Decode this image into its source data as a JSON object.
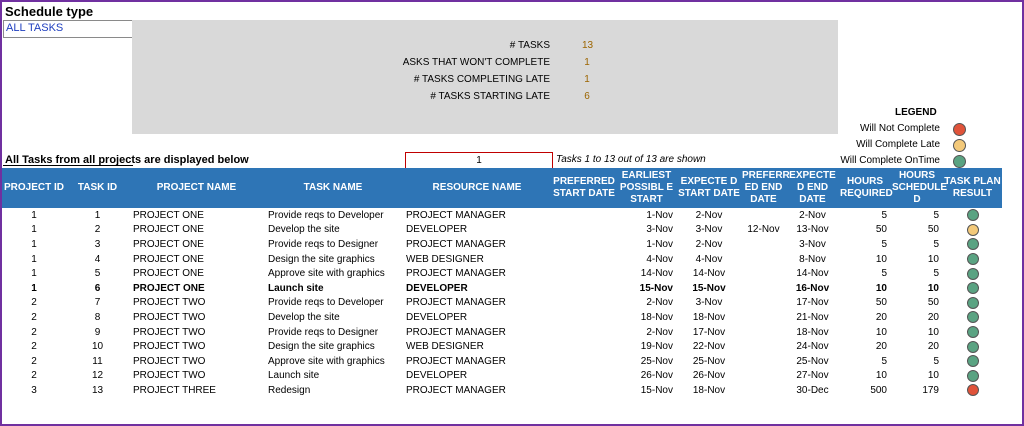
{
  "schedule": {
    "title": "Schedule type",
    "selected": "ALL TASKS"
  },
  "stats": [
    {
      "label": "# TASKS",
      "value": "13"
    },
    {
      "label": "ASKS THAT WON'T COMPLETE",
      "value": "1"
    },
    {
      "label": "# TASKS COMPLETING LATE",
      "value": "1"
    },
    {
      "label": "# TASKS STARTING LATE",
      "value": "6"
    }
  ],
  "legend": {
    "title": "LEGEND",
    "items": [
      {
        "label": "Will Not Complete",
        "color": "#e0533a"
      },
      {
        "label": "Will Complete Late",
        "color": "#f3c97a"
      },
      {
        "label": "Will Complete OnTime",
        "color": "#5aa382"
      }
    ]
  },
  "list_info": {
    "all_tasks_label": "All Tasks from all projects are displayed below",
    "page_value": "1",
    "shown_text": "Tasks 1 to 13 out of 13 are shown"
  },
  "columns": [
    "PROJECT ID",
    "TASK ID",
    "PROJECT NAME",
    "TASK NAME",
    "RESOURCE NAME",
    "PREFERRED START DATE",
    "EARLIEST POSSIBL E START",
    "EXPECTE D START DATE",
    "PREFERR ED END DATE",
    "EXPECTE D END DATE",
    "HOURS REQUIRED",
    "HOURS SCHEDULE D",
    "TASK PLAN RESULT"
  ],
  "rows": [
    {
      "project_id": "1",
      "task_id": "1",
      "project_name": "PROJECT ONE",
      "task_name": "Provide reqs to Developer",
      "resource": "PROJECT MANAGER",
      "pref_start": "",
      "earliest": "1-Nov",
      "exp_start": "2-Nov",
      "pref_end": "",
      "exp_end": "2-Nov",
      "hours_req": "5",
      "hours_sched": "5",
      "result": "green",
      "bold": false
    },
    {
      "project_id": "1",
      "task_id": "2",
      "project_name": "PROJECT ONE",
      "task_name": "Develop the site",
      "resource": "DEVELOPER",
      "pref_start": "",
      "earliest": "3-Nov",
      "exp_start": "3-Nov",
      "pref_end": "12-Nov",
      "exp_end": "13-Nov",
      "hours_req": "50",
      "hours_sched": "50",
      "result": "yellow",
      "bold": false
    },
    {
      "project_id": "1",
      "task_id": "3",
      "project_name": "PROJECT ONE",
      "task_name": "Provide reqs to Designer",
      "resource": "PROJECT MANAGER",
      "pref_start": "",
      "earliest": "1-Nov",
      "exp_start": "2-Nov",
      "pref_end": "",
      "exp_end": "3-Nov",
      "hours_req": "5",
      "hours_sched": "5",
      "result": "green",
      "bold": false
    },
    {
      "project_id": "1",
      "task_id": "4",
      "project_name": "PROJECT ONE",
      "task_name": "Design the site graphics",
      "resource": "WEB DESIGNER",
      "pref_start": "",
      "earliest": "4-Nov",
      "exp_start": "4-Nov",
      "pref_end": "",
      "exp_end": "8-Nov",
      "hours_req": "10",
      "hours_sched": "10",
      "result": "green",
      "bold": false
    },
    {
      "project_id": "1",
      "task_id": "5",
      "project_name": "PROJECT ONE",
      "task_name": "Approve site with graphics",
      "resource": "PROJECT MANAGER",
      "pref_start": "",
      "earliest": "14-Nov",
      "exp_start": "14-Nov",
      "pref_end": "",
      "exp_end": "14-Nov",
      "hours_req": "5",
      "hours_sched": "5",
      "result": "green",
      "bold": false
    },
    {
      "project_id": "1",
      "task_id": "6",
      "project_name": "PROJECT ONE",
      "task_name": "Launch site",
      "resource": "DEVELOPER",
      "pref_start": "",
      "earliest": "15-Nov",
      "exp_start": "15-Nov",
      "pref_end": "",
      "exp_end": "16-Nov",
      "hours_req": "10",
      "hours_sched": "10",
      "result": "green",
      "bold": true
    },
    {
      "project_id": "2",
      "task_id": "7",
      "project_name": "PROJECT TWO",
      "task_name": "Provide reqs to Developer",
      "resource": "PROJECT MANAGER",
      "pref_start": "",
      "earliest": "2-Nov",
      "exp_start": "3-Nov",
      "pref_end": "",
      "exp_end": "17-Nov",
      "hours_req": "50",
      "hours_sched": "50",
      "result": "green",
      "bold": false
    },
    {
      "project_id": "2",
      "task_id": "8",
      "project_name": "PROJECT TWO",
      "task_name": "Develop the site",
      "resource": "DEVELOPER",
      "pref_start": "",
      "earliest": "18-Nov",
      "exp_start": "18-Nov",
      "pref_end": "",
      "exp_end": "21-Nov",
      "hours_req": "20",
      "hours_sched": "20",
      "result": "green",
      "bold": false
    },
    {
      "project_id": "2",
      "task_id": "9",
      "project_name": "PROJECT TWO",
      "task_name": "Provide reqs to Designer",
      "resource": "PROJECT MANAGER",
      "pref_start": "",
      "earliest": "2-Nov",
      "exp_start": "17-Nov",
      "pref_end": "",
      "exp_end": "18-Nov",
      "hours_req": "10",
      "hours_sched": "10",
      "result": "green",
      "bold": false
    },
    {
      "project_id": "2",
      "task_id": "10",
      "project_name": "PROJECT TWO",
      "task_name": "Design the site graphics",
      "resource": "WEB DESIGNER",
      "pref_start": "",
      "earliest": "19-Nov",
      "exp_start": "22-Nov",
      "pref_end": "",
      "exp_end": "24-Nov",
      "hours_req": "20",
      "hours_sched": "20",
      "result": "green",
      "bold": false
    },
    {
      "project_id": "2",
      "task_id": "11",
      "project_name": "PROJECT TWO",
      "task_name": "Approve site with graphics",
      "resource": "PROJECT MANAGER",
      "pref_start": "",
      "earliest": "25-Nov",
      "exp_start": "25-Nov",
      "pref_end": "",
      "exp_end": "25-Nov",
      "hours_req": "5",
      "hours_sched": "5",
      "result": "green",
      "bold": false
    },
    {
      "project_id": "2",
      "task_id": "12",
      "project_name": "PROJECT TWO",
      "task_name": "Launch site",
      "resource": "DEVELOPER",
      "pref_start": "",
      "earliest": "26-Nov",
      "exp_start": "26-Nov",
      "pref_end": "",
      "exp_end": "27-Nov",
      "hours_req": "10",
      "hours_sched": "10",
      "result": "green",
      "bold": false
    },
    {
      "project_id": "3",
      "task_id": "13",
      "project_name": "PROJECT THREE",
      "task_name": "Redesign",
      "resource": "PROJECT MANAGER",
      "pref_start": "",
      "earliest": "15-Nov",
      "exp_start": "18-Nov",
      "pref_end": "",
      "exp_end": "30-Dec",
      "hours_req": "500",
      "hours_sched": "179",
      "result": "red",
      "bold": false
    }
  ],
  "result_colors": {
    "green": "#5aa382",
    "yellow": "#f3c97a",
    "red": "#e0533a"
  }
}
